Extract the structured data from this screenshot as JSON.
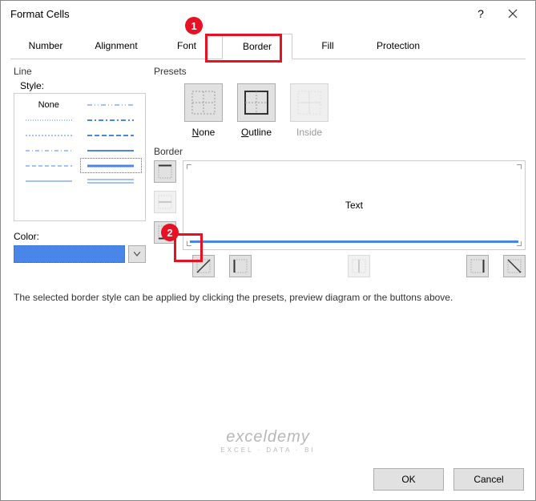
{
  "window": {
    "title": "Format Cells"
  },
  "tabs": [
    "Number",
    "Alignment",
    "Font",
    "Border",
    "Fill",
    "Protection"
  ],
  "active_tab_index": 3,
  "line": {
    "group": "Line",
    "style_label": "Style:",
    "none_label": "None",
    "color_label": "Color:",
    "color_value": "#4a86e8"
  },
  "presets": {
    "group": "Presets",
    "items": [
      {
        "label": "None",
        "key": "N"
      },
      {
        "label": "Outline",
        "key": "O"
      },
      {
        "label": "Inside",
        "key": "I",
        "disabled": true
      }
    ]
  },
  "border": {
    "group": "Border",
    "preview_text": "Text"
  },
  "hint": "The selected border style can be applied by clicking the presets, preview diagram or the buttons above.",
  "buttons": {
    "ok": "OK",
    "cancel": "Cancel"
  },
  "callouts": {
    "c1": "1",
    "c2": "2"
  },
  "watermark": {
    "line1": "exceldemy",
    "line2": "EXCEL · DATA · BI"
  }
}
